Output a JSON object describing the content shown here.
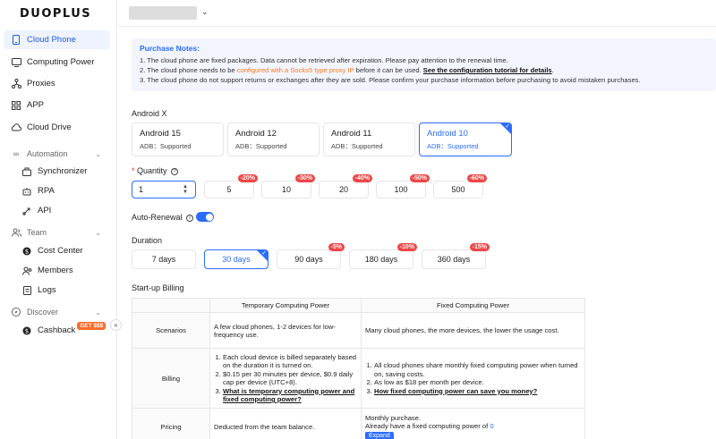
{
  "brand": {
    "logo": "DUOPLUS"
  },
  "sidebar": {
    "items": [
      {
        "label": "Cloud Phone",
        "icon": "phone-icon"
      },
      {
        "label": "Computing Power",
        "icon": "monitor-icon"
      },
      {
        "label": "Proxies",
        "icon": "proxy-icon"
      },
      {
        "label": "APP",
        "icon": "grid-icon"
      },
      {
        "label": "Cloud Drive",
        "icon": "cloud-icon"
      }
    ],
    "automation": {
      "label": "Automation",
      "items": [
        "Synchronizer",
        "RPA",
        "API"
      ]
    },
    "team": {
      "label": "Team",
      "items": [
        "Cost Center",
        "Members",
        "Logs"
      ]
    },
    "discover": {
      "label": "Discover",
      "items": [
        "Cashback"
      ],
      "badge": "GET $$$"
    },
    "collapse": "«"
  },
  "topbar": {
    "chevron": "⌄"
  },
  "notes": {
    "title": "Purchase Notes:",
    "line1": "1. The cloud phone are fixed packages. Data cannot be retrieved after expiration. Please pay attention to the renewal time.",
    "line2_a": "2. The cloud phone needs to be ",
    "line2_highlight": "configured with a Socks5 type proxy IP",
    "line2_b": " before it can be used. ",
    "line2_link": "See the configuration tutorial for details",
    "line2_c": ".",
    "line3": "3. The cloud phone do not support returns or exchanges after they are sold. Please confirm your purchase information before purchasing to avoid mistaken purchases."
  },
  "os": {
    "label": "Android X",
    "options": [
      {
        "name": "Android 15",
        "adb": "ADB：Supported"
      },
      {
        "name": "Android 12",
        "adb": "ADB：Supported"
      },
      {
        "name": "Android 11",
        "adb": "ADB：Supported"
      },
      {
        "name": "Android 10",
        "adb": "ADB：Supported"
      }
    ],
    "selected_index": 3
  },
  "quantity": {
    "required_mark": "*",
    "label": "Quantity",
    "value": "1",
    "options": [
      {
        "value": "5",
        "discount": "-20%"
      },
      {
        "value": "10",
        "discount": "-30%"
      },
      {
        "value": "20",
        "discount": "-40%"
      },
      {
        "value": "100",
        "discount": "-50%"
      },
      {
        "value": "500",
        "discount": "-60%"
      }
    ]
  },
  "auto_renewal": {
    "label": "Auto-Renewal",
    "on": true
  },
  "duration": {
    "label": "Duration",
    "options": [
      {
        "label": "7 days",
        "discount": ""
      },
      {
        "label": "30 days",
        "discount": ""
      },
      {
        "label": "90 days",
        "discount": "-5%"
      },
      {
        "label": "180 days",
        "discount": "-10%"
      },
      {
        "label": "360 days",
        "discount": "-15%"
      }
    ],
    "selected_index": 1
  },
  "billing": {
    "label": "Start-up Billing",
    "headers": [
      "Temporary Computing Power",
      "Fixed Computing Power"
    ],
    "rows": {
      "scenarios": {
        "label": "Scenarios",
        "temp": "A few cloud phones, 1-2 devices for low-frequency use.",
        "fixed": "Many cloud phones, the more devices, the lower the usage cost."
      },
      "billing": {
        "label": "Billing",
        "temp": [
          "Each cloud device is billed separately based on the duration it is turned on.",
          "$0.15 per 30 minutes per device, $0.9 daily cap per device (UTC+8)."
        ],
        "temp_link": "What is temporary computing power and fixed computing power?",
        "fixed": [
          "All cloud phones share monthly fixed computing power when turned on, saving costs.",
          "As low as $18 per month per device."
        ],
        "fixed_link": "How fixed computing power can save you money?"
      },
      "pricing": {
        "label": "Pricing",
        "temp": "Deducted from the team balance.",
        "fixed_line1": "Monthly purchase.",
        "fixed_line2": "Already have a fixed computing power of ",
        "fixed_value": "0",
        "expand": "Expand"
      }
    }
  },
  "colors": {
    "accent": "#2b6cff",
    "discount": "#f04545",
    "highlight": "#ff7a1a"
  }
}
